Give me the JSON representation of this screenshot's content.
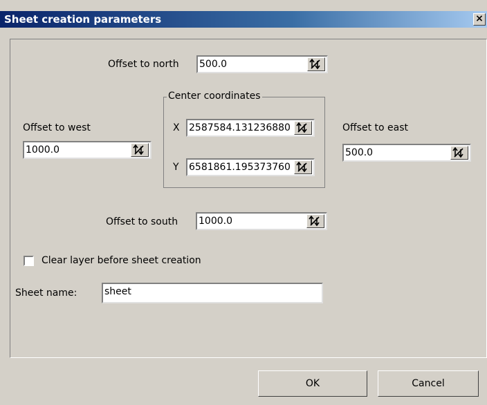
{
  "window": {
    "title": "Sheet creation parameters",
    "close_label": "×"
  },
  "offsets": {
    "north_label": "Offset to north",
    "north_value": "500.0",
    "west_label": "Offset to west",
    "west_value": "1000.0",
    "east_label": "Offset to east",
    "east_value": "500.0",
    "south_label": "Offset to south",
    "south_value": "1000.0"
  },
  "center": {
    "legend": "Center coordinates",
    "x_label": "X",
    "x_value": "2587584.131236880",
    "y_label": "Y",
    "y_value": "6581861.195373760"
  },
  "clear_layer": {
    "label": "Clear layer before sheet creation",
    "checked": false
  },
  "sheet_name": {
    "label": "Sheet name:",
    "value": "sheet"
  },
  "buttons": {
    "ok": "OK",
    "cancel": "Cancel"
  },
  "icons": {
    "spinner": "spinner-arrows-icon",
    "close": "close-icon"
  }
}
